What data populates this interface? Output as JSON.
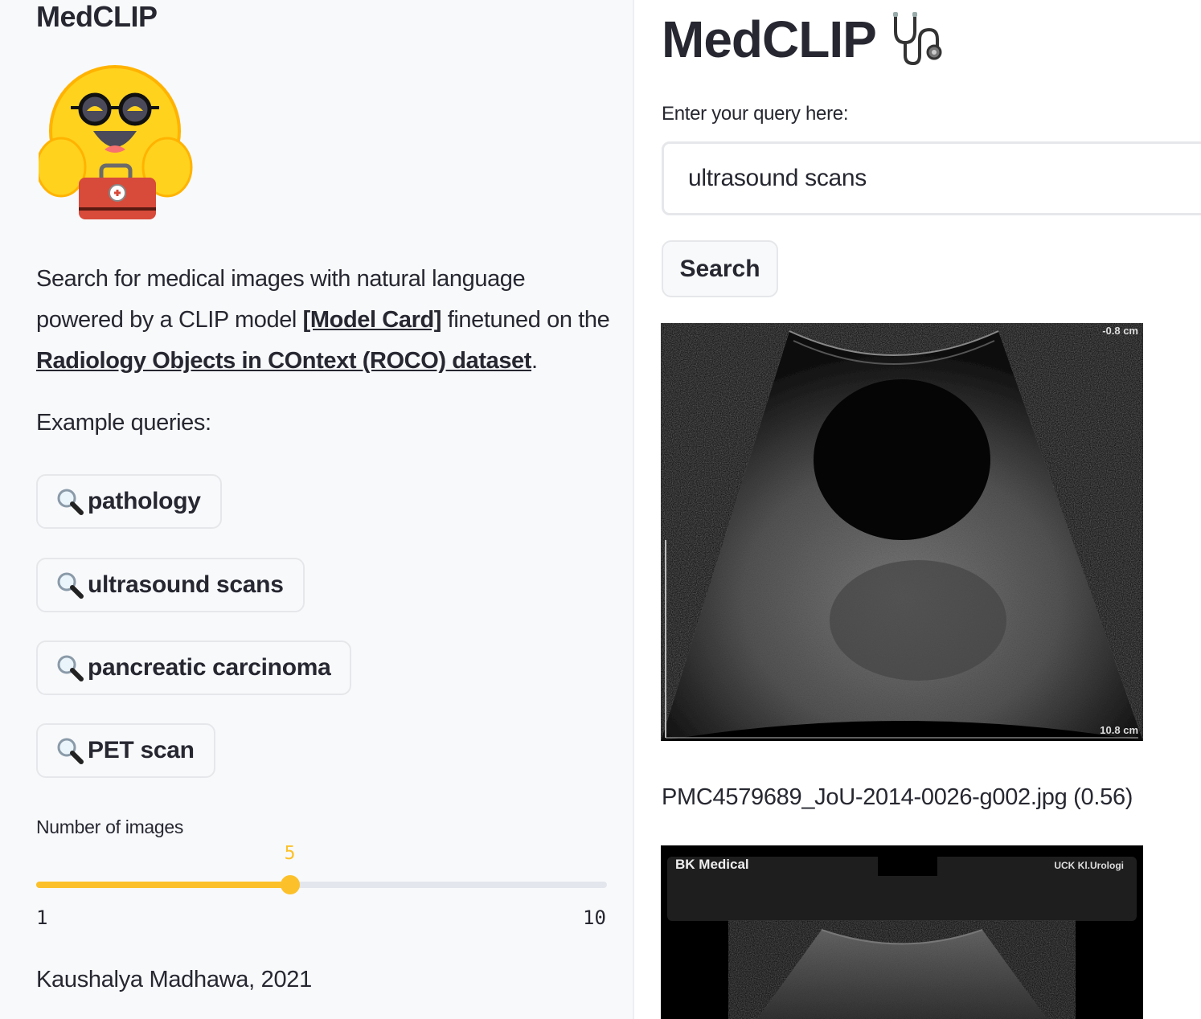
{
  "sidebar": {
    "title": "MedCLIP",
    "logo_icon": "hugging-face-doctor-bag-emoji",
    "description": {
      "part1": "Search for medical images with natural language powered by a CLIP model ",
      "model_card_link": "[Model Card]",
      "part2": " finetuned on the ",
      "dataset_link": "Radiology Objects in COntext (ROCO) dataset",
      "part3": "."
    },
    "examples_label": "Example queries:",
    "examples": [
      {
        "icon": "magnifying-glass-icon",
        "label": "pathology"
      },
      {
        "icon": "magnifying-glass-icon",
        "label": "ultrasound scans"
      },
      {
        "icon": "magnifying-glass-icon",
        "label": "pancreatic carcinoma"
      },
      {
        "icon": "magnifying-glass-icon",
        "label": "PET scan"
      }
    ],
    "slider": {
      "label": "Number of images",
      "min": 1,
      "max": 10,
      "value": 5,
      "min_label": "1",
      "max_label": "10",
      "value_label": "5",
      "accent_color": "#fcc12a"
    },
    "credit": "Kaushalya Madhawa, 2021"
  },
  "main": {
    "title": "MedCLIP",
    "title_icon": "stethoscope-icon",
    "query_label": "Enter your query here:",
    "query_value": "ultrasound scans",
    "search_label": "Search",
    "results": [
      {
        "caption": "PMC4579689_JoU-2014-0026-g002.jpg (0.56)",
        "overlay_top": "-0.8 cm",
        "overlay_bottom": "10.8 cm"
      },
      {
        "header_brand": "BK Medical",
        "header_right": "UCK Kl.Urologi"
      }
    ]
  }
}
